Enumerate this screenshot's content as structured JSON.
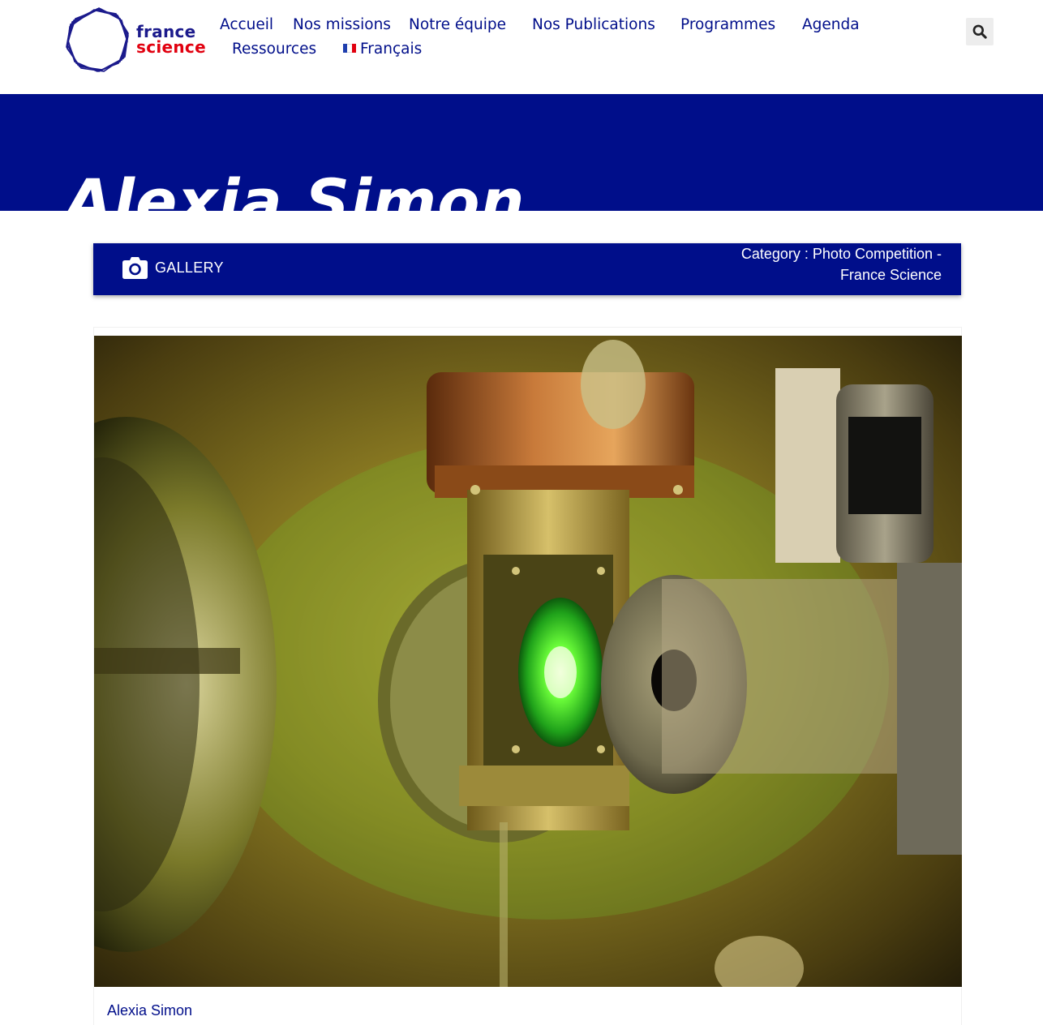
{
  "brand": {
    "word1": "france",
    "word2": "science"
  },
  "nav": {
    "items": [
      {
        "label": "Accueil"
      },
      {
        "label": "Nos missions"
      },
      {
        "label": "Notre équipe"
      },
      {
        "label": "Nos Publications"
      },
      {
        "label": "Programmes"
      },
      {
        "label": "Agenda"
      },
      {
        "label": "Ressources"
      }
    ],
    "language": "Français"
  },
  "page": {
    "title": "Alexia Simon"
  },
  "gallery_bar": {
    "label": "GALLERY",
    "category_line1": "Category : Photo Competition -",
    "category_line2": "France Science"
  },
  "card": {
    "caption": "Alexia Simon"
  },
  "colors": {
    "brand_blue": "#000e8a",
    "brand_red": "#e1000f",
    "search_bg": "#ededed"
  },
  "icons": {
    "search": "search-icon",
    "camera": "camera-icon",
    "flag": "flag-fr-icon"
  }
}
